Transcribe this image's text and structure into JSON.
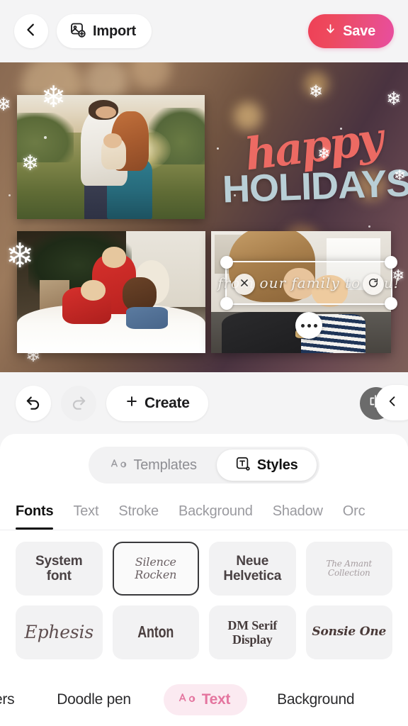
{
  "topbar": {
    "back_icon": "chevron-left-icon",
    "import_label": "Import",
    "import_icon": "image-plus-icon",
    "save_label": "Save",
    "save_icon": "download-arrow-icon",
    "save_gradient_from": "#ef4056",
    "save_gradient_to": "#e84ea0"
  },
  "canvas": {
    "headline_script": "happy",
    "headline_block": "HOLIDAYS",
    "headline_script_color": "#ec6a63",
    "headline_block_color": "#b9cfd6",
    "selected_text": "from our family to you!",
    "delete_icon": "close-x-icon",
    "rotate_icon": "rotate-icon",
    "more_icon": "more-dots-icon",
    "photos": [
      {
        "name": "family-in-field"
      },
      {
        "name": "kids-on-rug"
      },
      {
        "name": "mother-and-baby"
      }
    ]
  },
  "toolbar": {
    "undo_icon": "undo-arrow-icon",
    "redo_icon": "redo-arrow-icon",
    "create_label": "Create",
    "create_icon": "plus-icon",
    "flip_icon": "flip-horizontal-icon",
    "collapse_icon": "chevron-left-icon"
  },
  "panel": {
    "segments": [
      {
        "label": "Templates",
        "icon": "aa-icon",
        "active": false
      },
      {
        "label": "Styles",
        "icon": "text-box-icon",
        "active": true
      }
    ],
    "tabs": [
      {
        "label": "Fonts",
        "active": true
      },
      {
        "label": "Text",
        "active": false
      },
      {
        "label": "Stroke",
        "active": false
      },
      {
        "label": "Background",
        "active": false
      },
      {
        "label": "Shadow",
        "active": false
      },
      {
        "label": "Orc",
        "active": false
      }
    ],
    "fonts": [
      {
        "label": "System font",
        "style": "f-sans",
        "selected": false
      },
      {
        "label": "Silence Rocken",
        "style": "f-script",
        "selected": true
      },
      {
        "label": "Neue Helvetica",
        "style": "f-sans",
        "selected": false
      },
      {
        "label": "The Amant Collection",
        "style": "f-script-sm",
        "selected": false
      },
      {
        "label": "Ephesis",
        "style": "f-eph",
        "selected": false
      },
      {
        "label": "Anton",
        "style": "f-anton",
        "selected": false
      },
      {
        "label": "DM Serif Display",
        "style": "f-serif",
        "selected": false
      },
      {
        "label": "Sonsie One",
        "style": "f-sonsie",
        "selected": false
      }
    ]
  },
  "bottomnav": {
    "items": [
      {
        "label": "ers",
        "active": false,
        "icon": null
      },
      {
        "label": "Doodle pen",
        "active": false,
        "icon": null
      },
      {
        "label": "Text",
        "active": true,
        "icon": "aa-icon"
      },
      {
        "label": "Background",
        "active": false,
        "icon": null
      }
    ],
    "active_bg": "#fbeaf1",
    "active_color": "#e4759f"
  }
}
